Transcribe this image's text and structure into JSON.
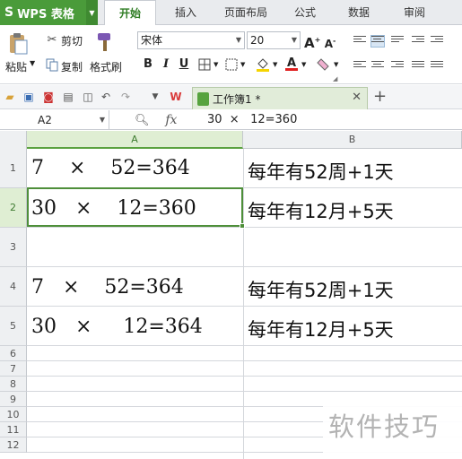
{
  "app": {
    "name": "WPS 表格",
    "logo": "S"
  },
  "tabs": [
    "开始",
    "插入",
    "页面布局",
    "公式",
    "数据",
    "审阅"
  ],
  "active_tab": "开始",
  "ribbon": {
    "paste": "粘贴",
    "cut": "剪切",
    "copy": "复制",
    "format_painter": "格式刷",
    "font_name": "宋体",
    "font_size": "20",
    "bold": "B",
    "italic": "I",
    "underline": "U",
    "grow_font": "A",
    "shrink_font": "A"
  },
  "doc_tab": {
    "title": "工作簿1 *"
  },
  "formula_bar": {
    "cell_ref": "A2",
    "fx": "fx",
    "content": "30  ×   12=360"
  },
  "columns": [
    "A",
    "B"
  ],
  "selected_column": "A",
  "rows": [
    "1",
    "2",
    "3",
    "4",
    "5",
    "6",
    "7",
    "8",
    "9",
    "10",
    "11",
    "12"
  ],
  "selected_row": "2",
  "cells": {
    "A1": "7    ×    52=364",
    "B1": "每年有52周+1天",
    "A2": "30   ×    12=360",
    "B2": "每年有12月+5天",
    "A4": "7   ×    52=364",
    "B4": "每年有52周+1天",
    "A5": "30   ×     12=364",
    "B5": "每年有12月+5天"
  },
  "watermark": "软件技巧",
  "colors": {
    "accent_green": "#4a9b3a",
    "selection_border": "#4e8f3a"
  }
}
